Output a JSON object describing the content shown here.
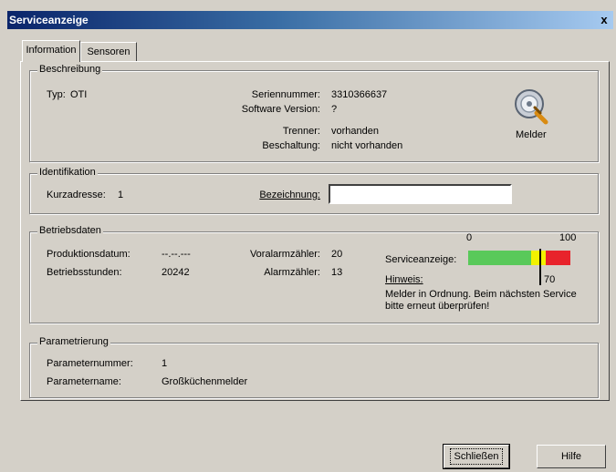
{
  "window": {
    "title": "Serviceanzeige",
    "close_label": "x"
  },
  "tabs": [
    {
      "label": "Information",
      "active": true
    },
    {
      "label": "Sensoren",
      "active": false
    }
  ],
  "beschreibung": {
    "legend": "Beschreibung",
    "typ_label": "Typ:",
    "typ_value": "OTI",
    "seriennummer_label": "Seriennummer:",
    "seriennummer_value": "3310366637",
    "software_label": "Software Version:",
    "software_value": "?",
    "trenner_label": "Trenner:",
    "trenner_value": "vorhanden",
    "beschaltung_label": "Beschaltung:",
    "beschaltung_value": "nicht vorhanden",
    "device_icon_caption": "Melder"
  },
  "identifikation": {
    "legend": "Identifikation",
    "kurzadresse_label": "Kurzadresse:",
    "kurzadresse_value": "1",
    "bezeichnung_label": "Bezeichnung:",
    "bezeichnung_value": ""
  },
  "betriebsdaten": {
    "legend": "Betriebsdaten",
    "produktionsdatum_label": "Produktionsdatum:",
    "produktionsdatum_value": "--.--.---",
    "betriebsstunden_label": "Betriebsstunden:",
    "betriebsstunden_value": "20242",
    "voralarm_label": "Voralarmzähler:",
    "voralarm_value": "20",
    "alarm_label": "Alarmzähler:",
    "alarm_value": "13",
    "serviceanzeige_label": "Serviceanzeige:",
    "scale_min": "0",
    "scale_max": "100",
    "marker_label": "70",
    "marker_value": 70,
    "hinweis_label": "Hinweis:",
    "hinweis_text": "Melder in Ordnung. Beim nächsten Service bitte erneut überprüfen!",
    "colors": {
      "green": "#59c95a",
      "yellow": "#f2f200",
      "red": "#e8232b"
    }
  },
  "parametrierung": {
    "legend": "Parametrierung",
    "nummer_label": "Parameternummer:",
    "nummer_value": "1",
    "name_label": "Parametername:",
    "name_value": "Großküchenmelder"
  },
  "buttons": {
    "close_label": "Schließen",
    "help_label": "Hilfe"
  }
}
